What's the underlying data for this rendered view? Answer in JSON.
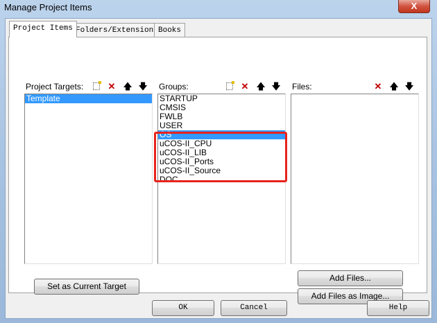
{
  "window": {
    "title": "Manage Project Items",
    "close_label": "X"
  },
  "tabs": [
    {
      "label": "Project Items",
      "active": true
    },
    {
      "label": "Folders/Extensions",
      "active": false
    },
    {
      "label": "Books",
      "active": false
    }
  ],
  "targets": {
    "label": "Project Targets:",
    "items": [
      "Template"
    ],
    "selected": 0
  },
  "groups": {
    "label": "Groups:",
    "items": [
      "STARTUP",
      "CMSIS",
      "FWLB",
      "USER",
      "OS",
      "uCOS-II_CPU",
      "uCOS-II_LIB",
      "uCOS-II_Ports",
      "uCOS-II_Source",
      "DOC"
    ],
    "selected": 4
  },
  "files": {
    "label": "Files:",
    "items": []
  },
  "buttons": {
    "set_current_target": "Set as Current Target",
    "add_files": "Add Files...",
    "add_files_as_image": "Add Files as Image...",
    "ok": "OK",
    "cancel": "Cancel",
    "help": "Help"
  },
  "icons": {
    "new": "new-item-icon",
    "delete": "delete-icon",
    "up": "move-up-icon",
    "down": "move-down-icon"
  },
  "colors": {
    "selection": "#3399ff",
    "highlight_box": "#e8231b"
  }
}
